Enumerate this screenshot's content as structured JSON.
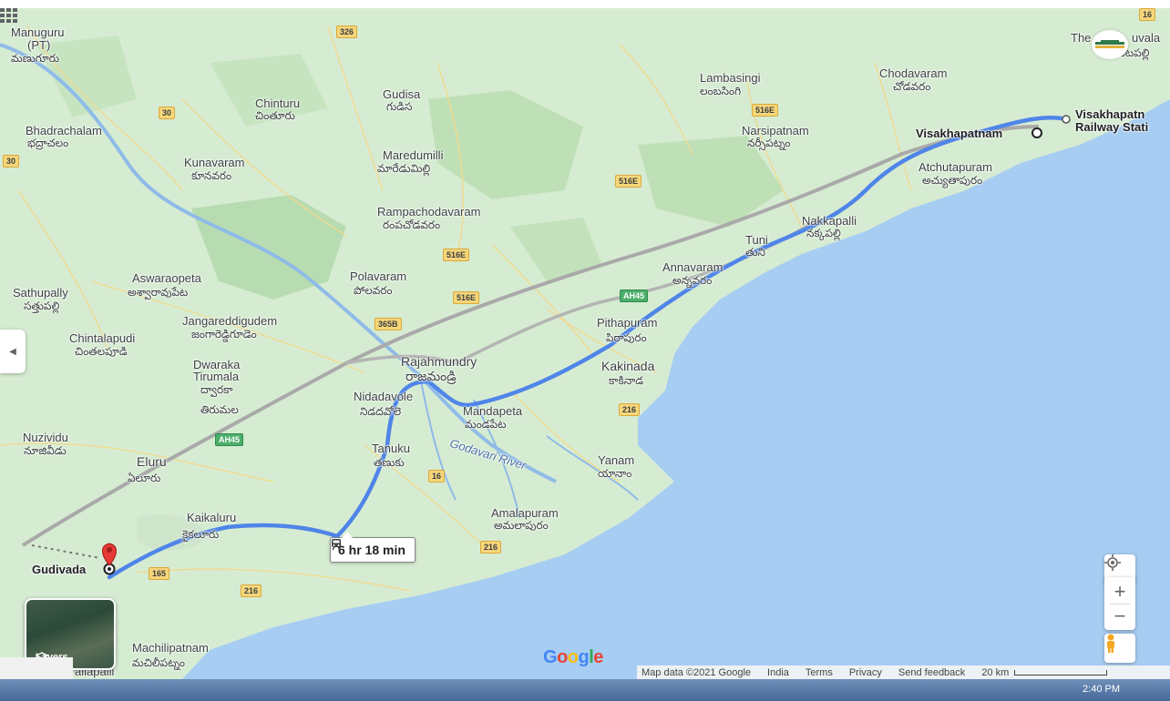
{
  "places": {
    "manuguru": "Manuguru",
    "manuguru_pt": "(PT)",
    "manuguru_te": "మణుగూరు",
    "bhadrachalam": "Bhadrachalam",
    "bhadrachalam_te": "భద్రాచలం",
    "kunavaram": "Kunavaram",
    "kunavaram_te": "కూనవరం",
    "chinturu": "Chinturu",
    "chinturu_te": "చింతూరు",
    "gudisa": "Gudisa",
    "gudisa_te": "గుడిస",
    "maredumilli": "Maredumilli",
    "maredumilli_te": "మారేడుమిల్లి",
    "rampachodavaram": "Rampachodavaram",
    "rampachodavaram_te": "రంపచోడవరం",
    "lambasingi": "Lambasingi",
    "lambasingi_te": "లంబసింగి",
    "chodavaram": "Chodavaram",
    "chodavaram_te": "చోడవరం",
    "narsipatnam": "Narsipatnam",
    "narsipatnam_te": "నర్సీపట్నం",
    "visakhapatnam": "Visakhapatnam",
    "visakhapatnam_station_1": "Visakhapatn",
    "visakhapatnam_station_2": "Railway Stati",
    "atchutapuram": "Atchutapuram",
    "atchutapuram_te": "అచ్యుతాపురం",
    "nakkapalli": "Nakkapalli",
    "nakkapalli_te": "నక్కపల్లి",
    "tuni": "Tuni",
    "tuni_te": "తుని",
    "annavaram": "Annavaram",
    "annavaram_te": "అన్నవరం",
    "aswaraopeta": "Aswaraopeta",
    "aswaraopeta_te": "అశ్వారావుపేట",
    "sathupally": "Sathupally",
    "sathupally_te": "సత్తుపల్లి",
    "polavaram": "Polavaram",
    "polavaram_te": "పోలవరం",
    "jangareddigudem": "Jangareddigudem",
    "jangareddigudem_te": "జంగారెడ్డిగూడెం",
    "chintalapudi": "Chintalapudi",
    "chintalapudi_te": "చింతలపూడి",
    "dwaraka_1": "Dwaraka",
    "dwaraka_2": "Tirumala",
    "dwaraka_te1": "ద్వారకా",
    "dwaraka_te2": "తిరుమల",
    "pithapuram": "Pithapuram",
    "pithapuram_te": "పిఠాపురం",
    "kakinada": "Kakinada",
    "kakinada_te": "కాకినాడ",
    "rajahmundry": "Rajahmundry",
    "rajahmundry_te": "రాజమండ్రి",
    "nidadavole": "Nidadavole",
    "nidadavole_te": "నిడదవోలె",
    "mandapeta": "Mandapeta",
    "mandapeta_te": "మండపేట",
    "nuzividu": "Nuzividu",
    "nuzividu_te": "నూజివీడు",
    "eluru": "Eluru",
    "eluru_te": "ఏలూరు",
    "tanuku": "Tanuku",
    "tanuku_te": "తణుకు",
    "yanam": "Yanam",
    "yanam_te": "యానాం",
    "kaikaluru": "Kaikaluru",
    "kaikaluru_te": "కైకలూరు",
    "amalapuram": "Amalapuram",
    "amalapuram_te": "అమలాపురం",
    "gudivada": "Gudivada",
    "machilipatnam": "Machilipatnam",
    "machilipatnam_te": "మచిలీపట్నం",
    "pallapalli": "allapalli",
    "thenmala_partial": "The",
    "partial_te": "ఉంగుటపల్లి",
    "partial_right": "uvala"
  },
  "river": "Godavari River",
  "roads": {
    "r326": "326",
    "r30a": "30",
    "r30b": "30",
    "r516e_a": "516E",
    "r516e_b": "516E",
    "r516e_c": "516E",
    "r516e_d": "516E",
    "r365b": "365B",
    "ah45_a": "AH45",
    "ah45_b": "AH45",
    "r216_a": "216",
    "r216_b": "216",
    "r216_c": "216",
    "r16": "16",
    "r165": "165",
    "r16_top": "16"
  },
  "route": {
    "duration": "6 hr 18 min",
    "mode_icon": "train-icon"
  },
  "layers_label": "Layers",
  "google_logo": {
    "G": "G",
    "o1": "o",
    "o2": "o",
    "g": "g",
    "l": "l",
    "e": "e"
  },
  "footer": {
    "map_data": "Map data ©2021 Google",
    "india": "India",
    "terms": "Terms",
    "privacy": "Privacy",
    "send_feedback": "Send feedback",
    "scale": "20 km"
  },
  "controls": {
    "zoom_in": "+",
    "zoom_out": "−"
  },
  "taskbar": {
    "clock": "2:40 PM"
  },
  "colors": {
    "land": "#d6ecd2",
    "water": "#a7cdf2",
    "route_blue": "#4f85e8",
    "route_gray": "#a9a9a9",
    "pin_red": "#e53935"
  }
}
